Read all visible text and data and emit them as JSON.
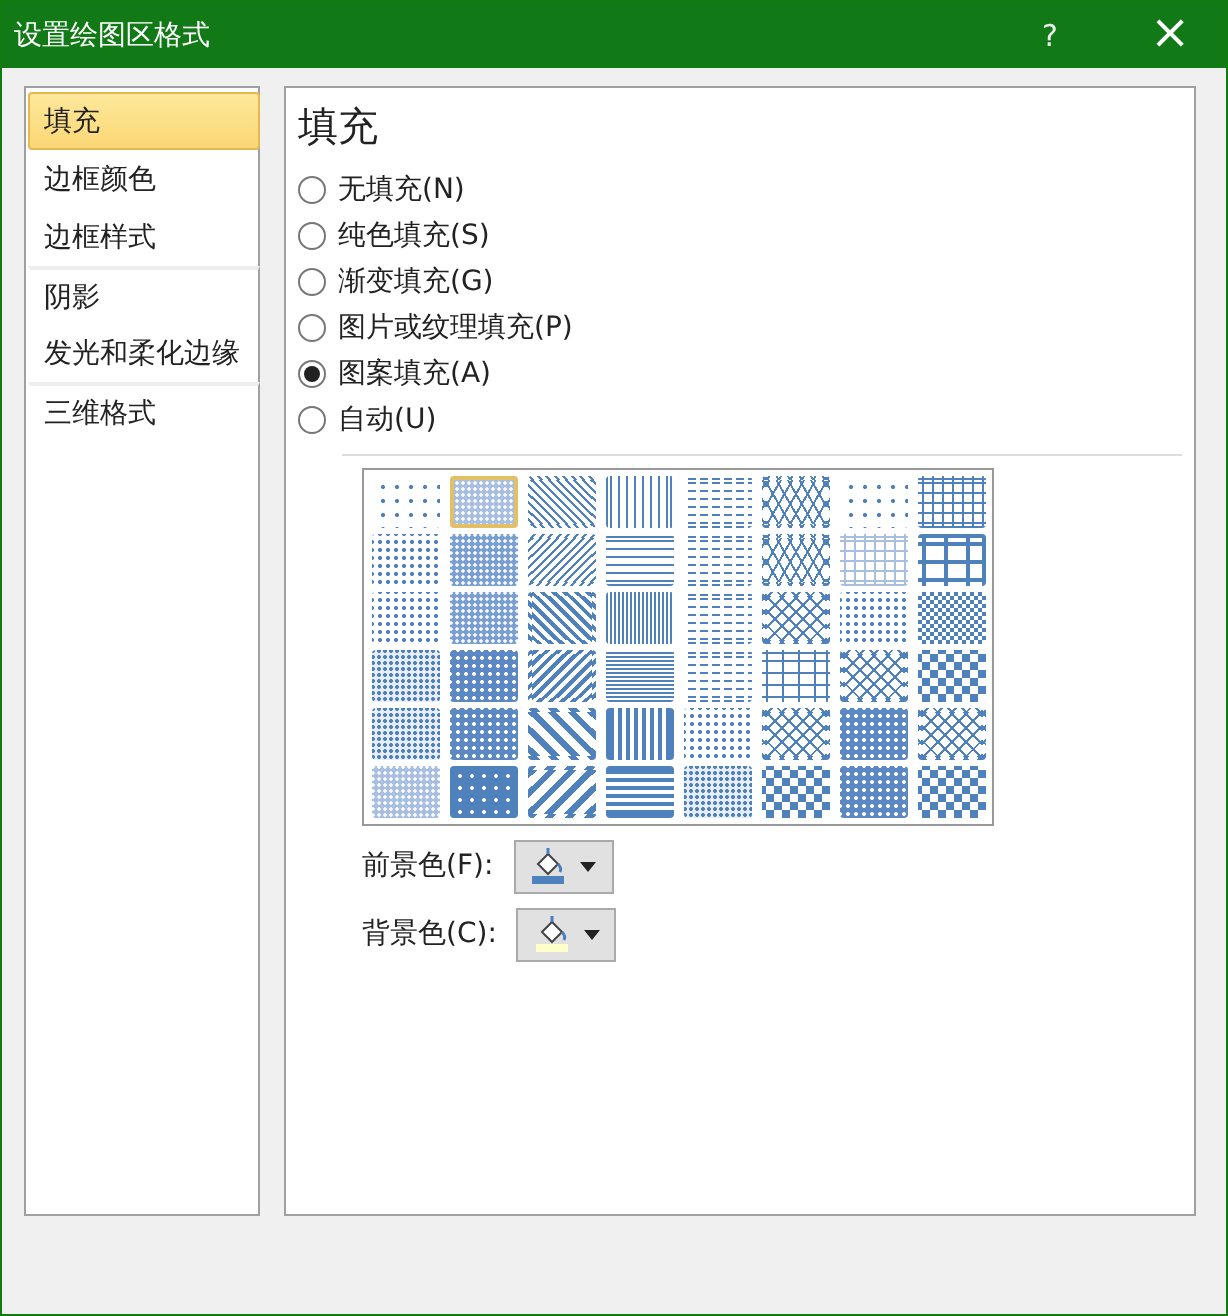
{
  "window": {
    "title": "设置绘图区格式",
    "help": "?",
    "close": "×"
  },
  "sidebar": {
    "items": [
      {
        "label": "填充",
        "selected": true,
        "group_start": false
      },
      {
        "label": "边框颜色",
        "selected": false,
        "group_start": false
      },
      {
        "label": "边框样式",
        "selected": false,
        "group_start": false
      },
      {
        "label": "阴影",
        "selected": false,
        "group_start": true
      },
      {
        "label": "发光和柔化边缘",
        "selected": false,
        "group_start": false
      },
      {
        "label": "三维格式",
        "selected": false,
        "group_start": true
      }
    ]
  },
  "panel": {
    "heading": "填充",
    "fill_options": [
      {
        "label": "无填充(N)",
        "selected": false
      },
      {
        "label": "纯色填充(S)",
        "selected": false
      },
      {
        "label": "渐变填充(G)",
        "selected": false
      },
      {
        "label": "图片或纹理填充(P)",
        "selected": false
      },
      {
        "label": "图案填充(A)",
        "selected": true
      },
      {
        "label": "自动(U)",
        "selected": false
      }
    ],
    "patterns": [
      {
        "kind": "dots-sparse",
        "selected": false
      },
      {
        "kind": "fill-light",
        "selected": true
      },
      {
        "kind": "diag-down",
        "selected": false
      },
      {
        "kind": "vertical",
        "selected": false
      },
      {
        "kind": "dashes",
        "selected": false
      },
      {
        "kind": "wave",
        "selected": false
      },
      {
        "kind": "dots-sparse",
        "selected": false
      },
      {
        "kind": "grid",
        "selected": false
      },
      {
        "kind": "dots",
        "selected": false
      },
      {
        "kind": "fill-mid",
        "selected": false
      },
      {
        "kind": "diag-up",
        "selected": false
      },
      {
        "kind": "horizontal",
        "selected": false
      },
      {
        "kind": "dashes",
        "selected": false
      },
      {
        "kind": "wave",
        "selected": false
      },
      {
        "kind": "grid-dotted",
        "selected": false
      },
      {
        "kind": "grid-large",
        "selected": false
      },
      {
        "kind": "dots",
        "selected": false
      },
      {
        "kind": "fill-mid",
        "selected": false
      },
      {
        "kind": "diag-down-bold",
        "selected": false
      },
      {
        "kind": "vertical-dense",
        "selected": false
      },
      {
        "kind": "dashes",
        "selected": false
      },
      {
        "kind": "diamond",
        "selected": false
      },
      {
        "kind": "dots",
        "selected": false
      },
      {
        "kind": "checker-small",
        "selected": false
      },
      {
        "kind": "dots-dense",
        "selected": false
      },
      {
        "kind": "fill-dark",
        "selected": false
      },
      {
        "kind": "diag-up-bold",
        "selected": false
      },
      {
        "kind": "horizontal-dense",
        "selected": false
      },
      {
        "kind": "dashes",
        "selected": false
      },
      {
        "kind": "brick",
        "selected": false
      },
      {
        "kind": "diamond",
        "selected": false
      },
      {
        "kind": "checker",
        "selected": false
      },
      {
        "kind": "dots-dense",
        "selected": false
      },
      {
        "kind": "fill-dark",
        "selected": false
      },
      {
        "kind": "diag-down-wide",
        "selected": false
      },
      {
        "kind": "vertical-bold",
        "selected": false
      },
      {
        "kind": "dots",
        "selected": false
      },
      {
        "kind": "diamond",
        "selected": false
      },
      {
        "kind": "fill-dark",
        "selected": false
      },
      {
        "kind": "diamond",
        "selected": false
      },
      {
        "kind": "fill-light",
        "selected": false
      },
      {
        "kind": "fill-darkest",
        "selected": false
      },
      {
        "kind": "diag-up-wide",
        "selected": false
      },
      {
        "kind": "horizontal-bold",
        "selected": false
      },
      {
        "kind": "dots-dense",
        "selected": false
      },
      {
        "kind": "checker",
        "selected": false
      },
      {
        "kind": "fill-dark",
        "selected": false
      },
      {
        "kind": "checker",
        "selected": false
      }
    ],
    "color_pickers": [
      {
        "label": "前景色(F):",
        "color": "#4f81bd"
      },
      {
        "label": "背景色(C):",
        "color": "#ffffcc"
      }
    ]
  }
}
